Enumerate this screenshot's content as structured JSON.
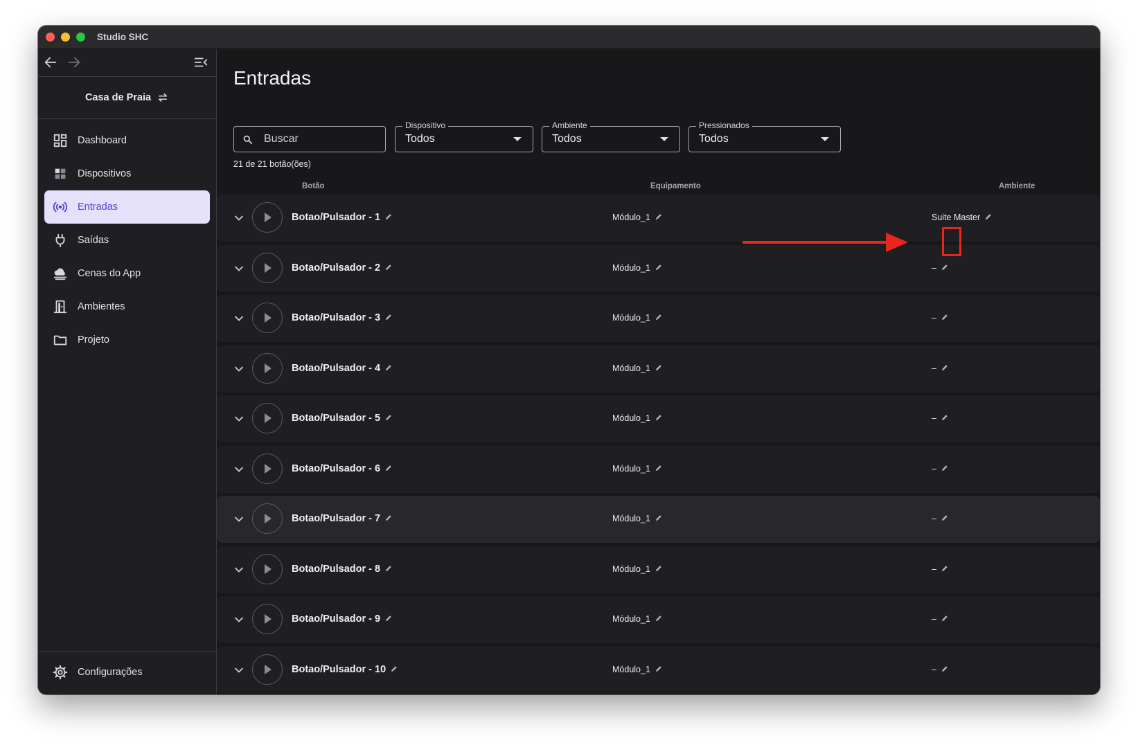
{
  "window": {
    "title": "Studio SHC"
  },
  "project": {
    "name": "Casa de Praia"
  },
  "sidebar": {
    "items": [
      {
        "label": "Dashboard",
        "icon": "dashboard-icon"
      },
      {
        "label": "Dispositivos",
        "icon": "devices-icon"
      },
      {
        "label": "Entradas",
        "icon": "input-signal-icon",
        "active": true
      },
      {
        "label": "Saídas",
        "icon": "plug-icon"
      },
      {
        "label": "Cenas do App",
        "icon": "cloud-scene-icon"
      },
      {
        "label": "Ambientes",
        "icon": "door-icon"
      },
      {
        "label": "Projeto",
        "icon": "folder-icon"
      }
    ],
    "settings_label": "Configurações"
  },
  "main": {
    "title": "Entradas",
    "search_placeholder": "Buscar",
    "filters": [
      {
        "label": "Dispositivo",
        "value": "Todos"
      },
      {
        "label": "Ambiente",
        "value": "Todos"
      },
      {
        "label": "Pressionados",
        "value": "Todos"
      }
    ],
    "count_text": "21 de 21 botão(ões)",
    "columns": {
      "button": "Botão",
      "equipment": "Equipamento",
      "environment": "Ambiente"
    },
    "rows": [
      {
        "name": "Botao/Pulsador - 1",
        "equipment": "Módulo_1",
        "environment": "Suite Master"
      },
      {
        "name": "Botao/Pulsador - 2",
        "equipment": "Módulo_1",
        "environment": "–"
      },
      {
        "name": "Botao/Pulsador - 3",
        "equipment": "Módulo_1",
        "environment": "–"
      },
      {
        "name": "Botao/Pulsador - 4",
        "equipment": "Módulo_1",
        "environment": "–"
      },
      {
        "name": "Botao/Pulsador - 5",
        "equipment": "Módulo_1",
        "environment": "–"
      },
      {
        "name": "Botao/Pulsador - 6",
        "equipment": "Módulo_1",
        "environment": "–"
      },
      {
        "name": "Botao/Pulsador - 7",
        "equipment": "Módulo_1",
        "environment": "–"
      },
      {
        "name": "Botao/Pulsador - 8",
        "equipment": "Módulo_1",
        "environment": "–"
      },
      {
        "name": "Botao/Pulsador - 9",
        "equipment": "Módulo_1",
        "environment": "–"
      },
      {
        "name": "Botao/Pulsador - 10",
        "equipment": "Módulo_1",
        "environment": "–"
      }
    ]
  },
  "colors": {
    "accent": "#5a3fd4",
    "active_bg": "#e6e1fb",
    "annotation": "#e8261b",
    "background": "#18181b"
  }
}
